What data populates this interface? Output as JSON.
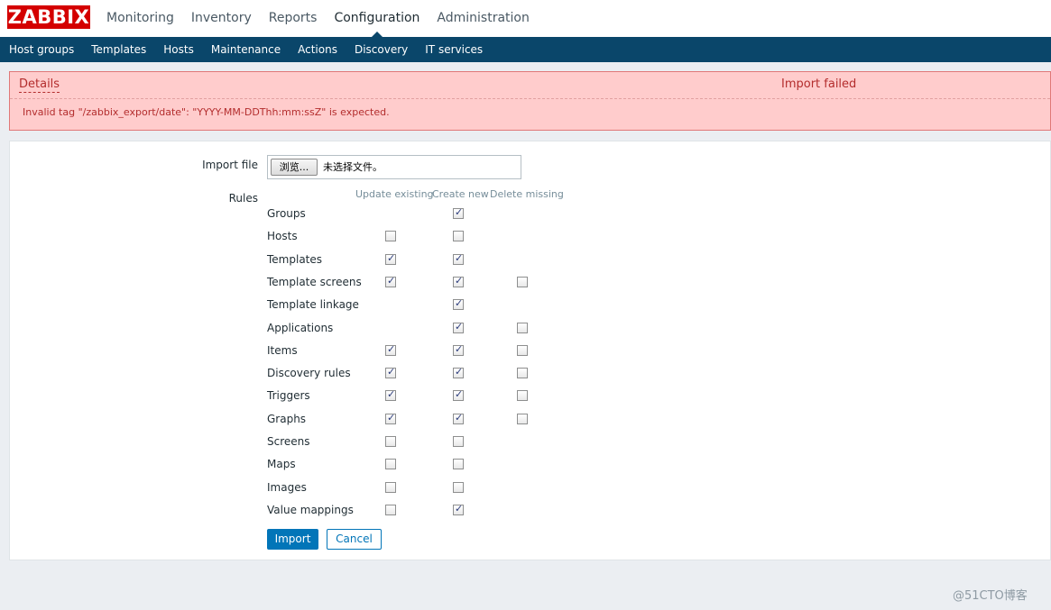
{
  "header": {
    "logo": "ZABBIX",
    "menu": [
      "Monitoring",
      "Inventory",
      "Reports",
      "Configuration",
      "Administration"
    ],
    "active_menu": "Configuration"
  },
  "submenu": [
    "Host groups",
    "Templates",
    "Hosts",
    "Maintenance",
    "Actions",
    "Discovery",
    "IT services"
  ],
  "message": {
    "details_link": "Details",
    "title": "Import failed",
    "text": "Invalid tag \"/zabbix_export/date\": \"YYYY-MM-DDThh:mm:ssZ\" is expected."
  },
  "form": {
    "import_file_label": "Import file",
    "browse_button": "浏览...",
    "no_file_text": "未选择文件。",
    "rules_label": "Rules",
    "columns": [
      "Update existing",
      "Create new",
      "Delete missing"
    ],
    "rules": [
      {
        "name": "Groups",
        "update": null,
        "create": true,
        "delete": null
      },
      {
        "name": "Hosts",
        "update": false,
        "create": false,
        "delete": null
      },
      {
        "name": "Templates",
        "update": true,
        "create": true,
        "delete": null
      },
      {
        "name": "Template screens",
        "update": true,
        "create": true,
        "delete": false
      },
      {
        "name": "Template linkage",
        "update": null,
        "create": true,
        "delete": null
      },
      {
        "name": "Applications",
        "update": null,
        "create": true,
        "delete": false
      },
      {
        "name": "Items",
        "update": true,
        "create": true,
        "delete": false
      },
      {
        "name": "Discovery rules",
        "update": true,
        "create": true,
        "delete": false
      },
      {
        "name": "Triggers",
        "update": true,
        "create": true,
        "delete": false
      },
      {
        "name": "Graphs",
        "update": true,
        "create": true,
        "delete": false
      },
      {
        "name": "Screens",
        "update": false,
        "create": false,
        "delete": null
      },
      {
        "name": "Maps",
        "update": false,
        "create": false,
        "delete": null
      },
      {
        "name": "Images",
        "update": false,
        "create": false,
        "delete": null
      },
      {
        "name": "Value mappings",
        "update": false,
        "create": true,
        "delete": null
      }
    ],
    "import_button": "Import",
    "cancel_button": "Cancel"
  },
  "watermark": "@51CTO博客",
  "colors": {
    "logo_bg": "#d40000",
    "submenu_bg": "#0a466a",
    "error_bg": "#ffcccc",
    "error_text": "#b32d2d",
    "primary_button": "#0275b8"
  }
}
